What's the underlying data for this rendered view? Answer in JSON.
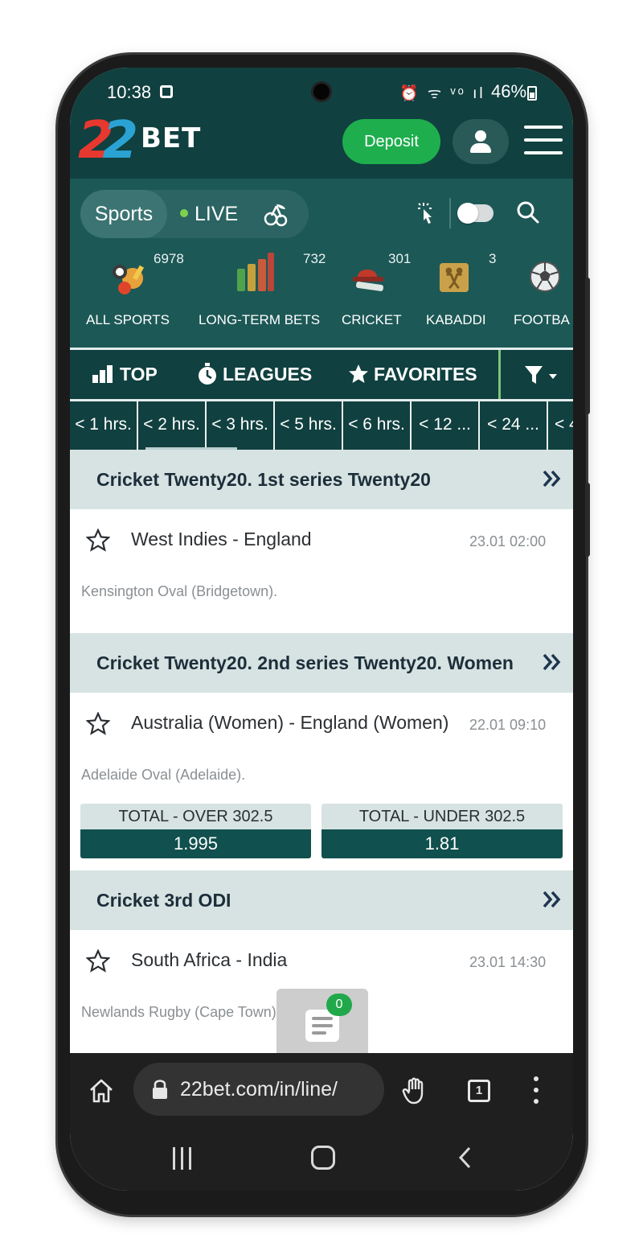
{
  "status_bar": {
    "time": "10:38",
    "icons": "⏰ ᯤ ᵛᵒ ıl",
    "battery": "46%"
  },
  "header": {
    "logo_digits": [
      "2",
      "2"
    ],
    "logo_word": "BET",
    "deposit_label": "Deposit"
  },
  "nav": {
    "sports_label": "Sports",
    "live_label": "LIVE",
    "categories": [
      {
        "label": "ALL SPORTS",
        "count": "6978",
        "icon": "all-sports-icon"
      },
      {
        "label": "LONG-TERM BETS",
        "count": "732",
        "icon": "bar-chart-icon"
      },
      {
        "label": "CRICKET",
        "count": "301",
        "icon": "cricket-icon"
      },
      {
        "label": "KABADDI",
        "count": "3",
        "icon": "kabaddi-icon"
      },
      {
        "label": "FOOTBA",
        "count": "",
        "icon": "football-icon"
      }
    ]
  },
  "tabs": {
    "top": "TOP",
    "leagues": "LEAGUES",
    "favorites": "FAVORITES"
  },
  "time_filters": [
    "< 1 hrs.",
    "< 2 hrs.",
    "< 3 hrs.",
    "< 5 hrs.",
    "< 6 hrs.",
    "< 12 ...",
    "< 24 ...",
    "< 4"
  ],
  "events": [
    {
      "championship": "Cricket Twenty20. 1st series Twenty20",
      "match": "West Indies - England",
      "datetime": "23.01 02:00",
      "venue": "Kensington Oval (Bridgetown)."
    },
    {
      "championship": "Cricket Twenty20. 2nd series Twenty20. Women",
      "match": "Australia (Women) - England (Women)",
      "datetime": "22.01 09:10",
      "venue": "Adelaide Oval (Adelaide).",
      "odds": [
        {
          "label": "TOTAL - OVER 302.5",
          "value": "1.995"
        },
        {
          "label": "TOTAL - UNDER 302.5",
          "value": "1.81"
        }
      ]
    },
    {
      "championship": "Cricket 3rd ODI",
      "match": "South Africa - India",
      "datetime": "23.01 14:30",
      "venue": "Newlands Rugby (Cape Town)."
    }
  ],
  "betslip": {
    "count": "0"
  },
  "browser": {
    "url": "22bet.com/in/line/",
    "tab_count": "1"
  },
  "colors": {
    "brand_dark": "#10403f",
    "brand_mid": "#1c5856",
    "deposit_green": "#1fae4e",
    "odds_bg": "#10504e",
    "champ_bg": "#d6e3e2"
  }
}
